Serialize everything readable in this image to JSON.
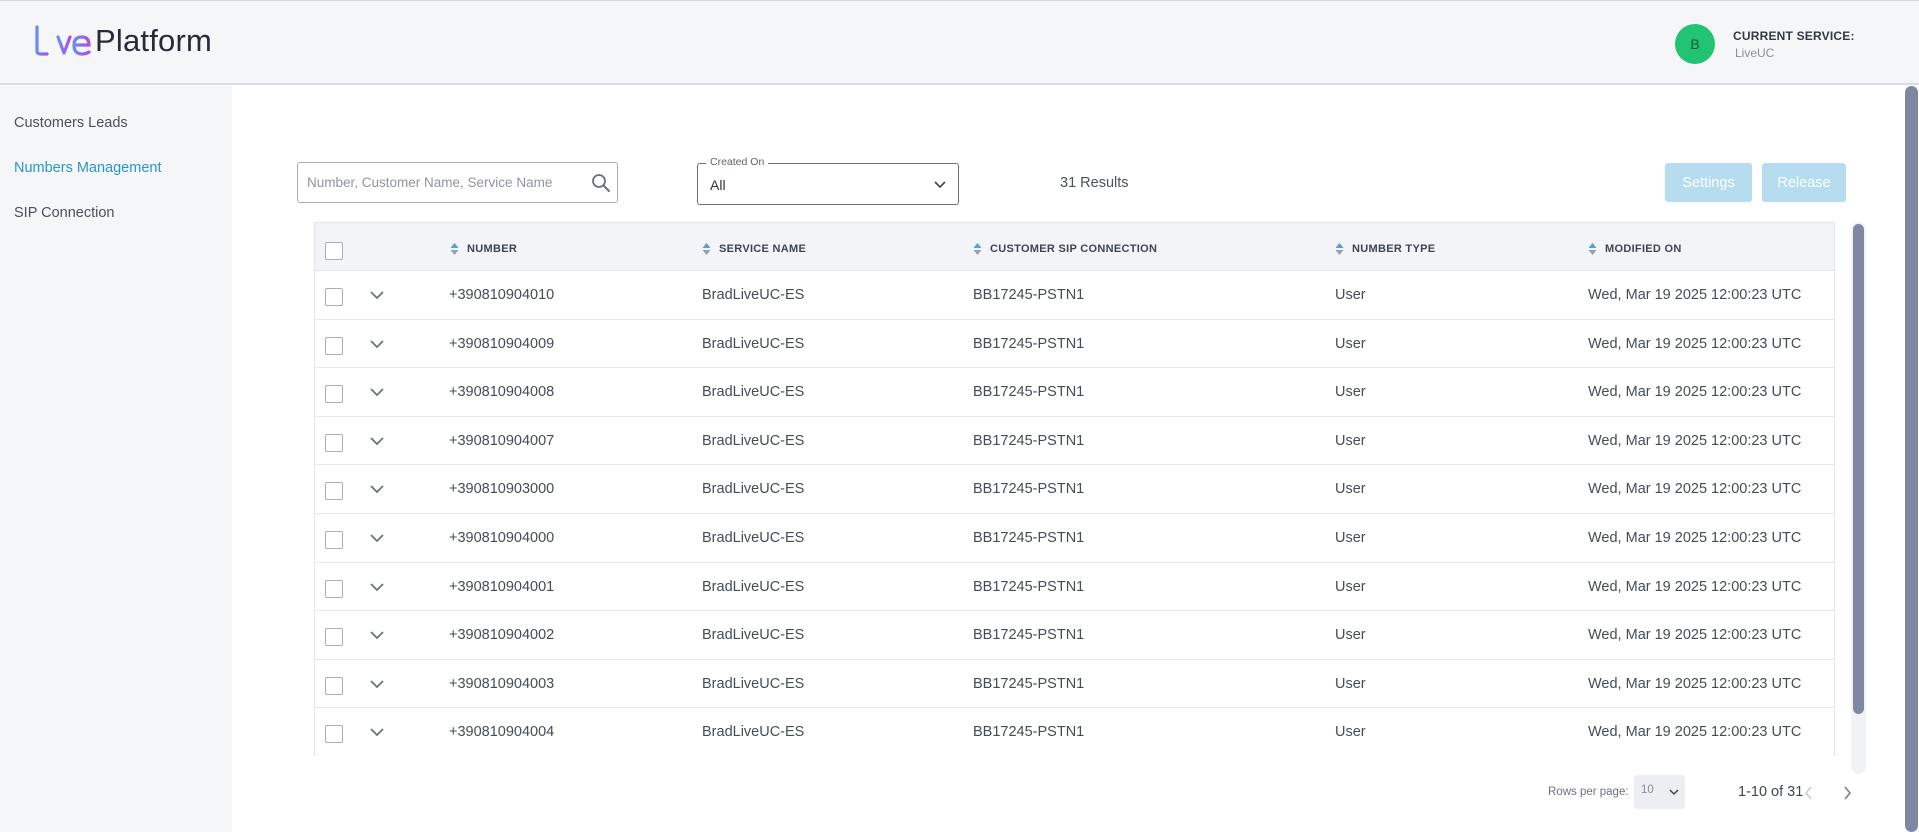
{
  "header": {
    "logo_live": "Live",
    "logo_platform": "Platform",
    "avatar_initial": "B",
    "current_service_label": "CURRENT SERVICE:",
    "current_service_value": "LiveUC"
  },
  "sidebar": {
    "items": [
      {
        "label": "Customers Leads",
        "active": false
      },
      {
        "label": "Numbers Management",
        "active": true
      },
      {
        "label": "SIP Connection",
        "active": false
      }
    ]
  },
  "toolbar": {
    "search_placeholder": "Number, Customer Name, Service Name",
    "search_value": "",
    "created_on_label": "Created On",
    "created_on_value": "All",
    "results_text": "31 Results",
    "settings_label": "Settings",
    "release_label": "Release"
  },
  "table": {
    "columns": [
      "NUMBER",
      "SERVICE NAME",
      "CUSTOMER SIP CONNECTION",
      "NUMBER TYPE",
      "MODIFIED ON"
    ],
    "rows": [
      {
        "number": "+390810904010",
        "service": "BradLiveUC-ES",
        "sip": "BB17245-PSTN1",
        "type": "User",
        "modified": "Wed, Mar 19 2025 12:00:23 UTC"
      },
      {
        "number": "+390810904009",
        "service": "BradLiveUC-ES",
        "sip": "BB17245-PSTN1",
        "type": "User",
        "modified": "Wed, Mar 19 2025 12:00:23 UTC"
      },
      {
        "number": "+390810904008",
        "service": "BradLiveUC-ES",
        "sip": "BB17245-PSTN1",
        "type": "User",
        "modified": "Wed, Mar 19 2025 12:00:23 UTC"
      },
      {
        "number": "+390810904007",
        "service": "BradLiveUC-ES",
        "sip": "BB17245-PSTN1",
        "type": "User",
        "modified": "Wed, Mar 19 2025 12:00:23 UTC"
      },
      {
        "number": "+390810903000",
        "service": "BradLiveUC-ES",
        "sip": "BB17245-PSTN1",
        "type": "User",
        "modified": "Wed, Mar 19 2025 12:00:23 UTC"
      },
      {
        "number": "+390810904000",
        "service": "BradLiveUC-ES",
        "sip": "BB17245-PSTN1",
        "type": "User",
        "modified": "Wed, Mar 19 2025 12:00:23 UTC"
      },
      {
        "number": "+390810904001",
        "service": "BradLiveUC-ES",
        "sip": "BB17245-PSTN1",
        "type": "User",
        "modified": "Wed, Mar 19 2025 12:00:23 UTC"
      },
      {
        "number": "+390810904002",
        "service": "BradLiveUC-ES",
        "sip": "BB17245-PSTN1",
        "type": "User",
        "modified": "Wed, Mar 19 2025 12:00:23 UTC"
      },
      {
        "number": "+390810904003",
        "service": "BradLiveUC-ES",
        "sip": "BB17245-PSTN1",
        "type": "User",
        "modified": "Wed, Mar 19 2025 12:00:23 UTC"
      },
      {
        "number": "+390810904004",
        "service": "BradLiveUC-ES",
        "sip": "BB17245-PSTN1",
        "type": "User",
        "modified": "Wed, Mar 19 2025 12:00:23 UTC"
      }
    ]
  },
  "pagination": {
    "rows_per_page_label": "Rows per page:",
    "rows_per_page_value": "10",
    "range_text": "1-10 of 31"
  },
  "icons": {
    "search": "search-icon",
    "dropdown": "chevron-down-icon",
    "sort": "sort-icon",
    "expand": "expand-chevron-icon",
    "prev": "chevron-left-icon",
    "next": "chevron-right-icon"
  },
  "colors": {
    "accent": "#2a97c9",
    "button_disabled": "#b6dcef",
    "avatar": "#22c474",
    "sort_up": "#4aa3dc",
    "sort_down": "#9aa0ab",
    "scrollbar": "#7f87a3"
  }
}
